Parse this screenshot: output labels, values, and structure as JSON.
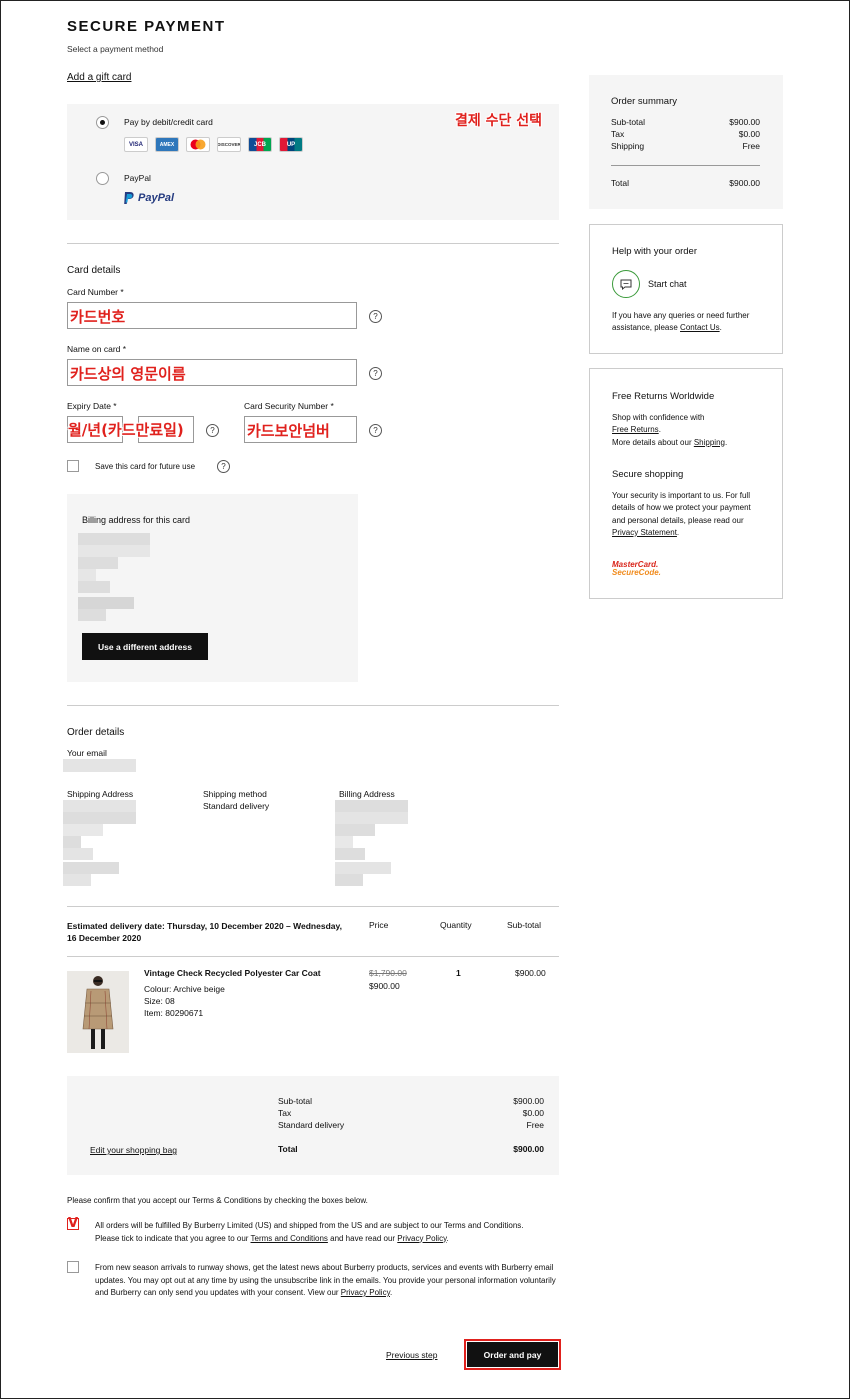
{
  "header": {
    "title": "SECURE PAYMENT",
    "subtitle": "Select a payment method",
    "gift_card_link": "Add a gift card"
  },
  "payment_methods": {
    "annotation": "결제 수단 선택",
    "card_option_label": "Pay by debit/credit card",
    "card_logos": [
      "VISA",
      "AMEX",
      "MC",
      "DISCOVER",
      "JCB",
      "UP"
    ],
    "paypal_option_label": "PayPal",
    "paypal_logo_text": "PayPal"
  },
  "card_details": {
    "title": "Card details",
    "card_number_label": "Card Number *",
    "card_number_annotation": "카드번호",
    "name_label": "Name on card *",
    "name_annotation": "카드상의 영문이름",
    "expiry_label": "Expiry Date *",
    "expiry_annotation": "월/년(카드만료일)",
    "security_label": "Card Security Number *",
    "security_annotation": "카드보안넘버",
    "save_card_label": "Save this card for future use",
    "help_glyph": "?"
  },
  "billing": {
    "title": "Billing address for this card",
    "button_label": "Use a different address"
  },
  "order_details": {
    "title": "Order details",
    "email_label": "Your email",
    "shipping_address_label": "Shipping Address",
    "shipping_method_label": "Shipping method",
    "shipping_method_value": "Standard delivery",
    "billing_address_label": "Billing Address"
  },
  "items_table": {
    "delivery_estimate": "Estimated delivery date: Thursday, 10 December 2020 – Wednesday, 16 December 2020",
    "col_price": "Price",
    "col_quantity": "Quantity",
    "col_subtotal": "Sub-total",
    "item": {
      "name": "Vintage Check Recycled Polyester Car Coat",
      "colour": "Colour: Archive beige",
      "size": "Size: 08",
      "item_no": "Item: 80290671",
      "original_price": "$1,790.00",
      "price": "$900.00",
      "quantity": "1",
      "subtotal": "$900.00"
    }
  },
  "totals": {
    "subtotal_label": "Sub-total",
    "subtotal_value": "$900.00",
    "tax_label": "Tax",
    "tax_value": "$0.00",
    "delivery_label": "Standard delivery",
    "delivery_value": "Free",
    "total_label": "Total",
    "total_value": "$900.00",
    "edit_bag_link": "Edit your shopping bag"
  },
  "terms": {
    "intro": "Please confirm that you accept our Terms & Conditions by checking the boxes below.",
    "check_mark": "V",
    "terms_text_1": "All orders will be fulfilled By Burberry Limited (US) and shipped from the US and are subject to our Terms and Conditions.",
    "terms_text_2_pre": "Please tick to indicate that you agree to our ",
    "terms_link": "Terms and Conditions",
    "terms_text_2_mid": " and have read our ",
    "privacy_link": "Privacy Policy",
    "terms_text_2_end": ".",
    "marketing_text": "From new season arrivals to runway shows, get the latest news about Burberry products, services and events with Burberry email updates. You may opt out at any time by using the unsubscribe link in the emails. You provide your personal information voluntarily and Burberry can only send you updates with your consent. View our ",
    "marketing_privacy_link": "Privacy Policy",
    "marketing_end": "."
  },
  "footer": {
    "previous_step": "Previous step",
    "order_and_pay": "Order and pay"
  },
  "sidebar": {
    "summary": {
      "title": "Order summary",
      "subtotal_label": "Sub-total",
      "subtotal_value": "$900.00",
      "tax_label": "Tax",
      "tax_value": "$0.00",
      "shipping_label": "Shipping",
      "shipping_value": "Free",
      "total_label": "Total",
      "total_value": "$900.00"
    },
    "help": {
      "title": "Help with your order",
      "chat_label": "Start chat",
      "text_pre": "If you have any queries or need further assistance, please ",
      "contact_link": "Contact Us",
      "text_end": "."
    },
    "returns": {
      "title": "Free Returns Worldwide",
      "line1": "Shop with confidence with",
      "free_returns_link": "Free Returns",
      "line2_pre": "More details about our ",
      "shipping_link": "Shipping",
      "secure_title": "Secure shopping",
      "secure_text": "Your security is important to us. For full details of how we protect your payment and personal details, please read our ",
      "privacy_link": "Privacy Statement",
      "mc_line1": "MasterCard.",
      "mc_line2": "SecureCode."
    }
  },
  "colors": {
    "annotation_red": "#e0211d",
    "panel_grey": "#f5f5f5",
    "button_black": "#111111",
    "paypal_blue": "#253b80",
    "paypal_light": "#179bd7"
  }
}
